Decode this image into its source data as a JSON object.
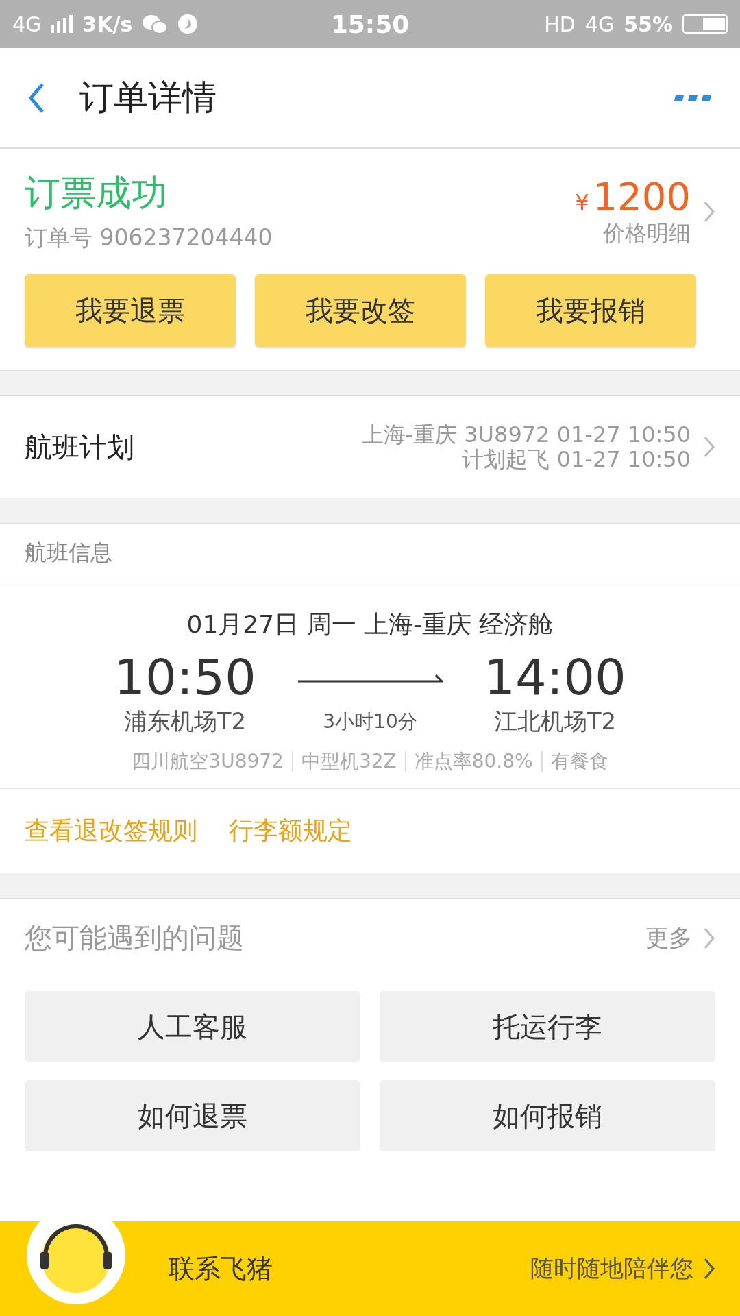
{
  "status_bar": {
    "network": "4G",
    "speed": "3K/s",
    "time": "15:50",
    "hd": "HD",
    "network_right": "4G",
    "battery": "55%"
  },
  "header": {
    "title": "订单详情"
  },
  "order": {
    "status": "订票成功",
    "order_number": "订单号 906237204440",
    "currency": "¥",
    "price": "1200",
    "price_detail": "价格明细",
    "actions": [
      "我要退票",
      "我要改签",
      "我要报销"
    ]
  },
  "flight_plan": {
    "label": "航班计划",
    "line_1": "上海-重庆 3U8972 01-27 10:50",
    "line_2": "计划起飞 01-27 10:50"
  },
  "flight_info": {
    "heading": "航班信息",
    "date_line": "01月27日 周一 上海-重庆 经济舱",
    "depart_time": "10:50",
    "arrive_time": "14:00",
    "duration": "3小时10分",
    "depart_airport": "浦东机场T2",
    "arrive_airport": "江北机场T2",
    "details": [
      "四川航空3U8972",
      "中型机32Z",
      "准点率80.8%",
      "有餐食"
    ],
    "links": [
      "查看退改签规则",
      "行李额规定"
    ]
  },
  "questions": {
    "title": "您可能遇到的问题",
    "more": "更多",
    "items": [
      "人工客服",
      "托运行李",
      "如何退票",
      "如何报销"
    ]
  },
  "contact_bar": {
    "label": "联系飞猪",
    "tagline": "随时随地陪伴您"
  }
}
